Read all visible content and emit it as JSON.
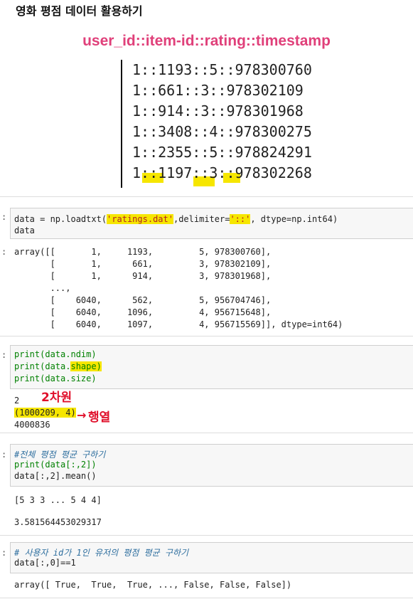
{
  "page": {
    "title": "영화 평점 데이터 활용하기",
    "subtitle": "user_id::item-id::rating::timestamp"
  },
  "rating_lines": [
    "1::1193::5::978300760",
    "1::661::3::978302109",
    "1::914::3::978301968",
    "1::3408::4::978300275",
    "1::2355::5::978824291",
    "1::1197::3::978302268"
  ],
  "cells": {
    "c1": {
      "prompt": ":",
      "code_line1": {
        "a": "data = np.loadtxt(",
        "s1": "'ratings.dat'",
        "b": ",delimiter=",
        "s2": "'::'",
        "c": ", dtype=np.int64)"
      },
      "code_line2": "data",
      "out_prompt": ":",
      "output": [
        "array([[       1,     1193,         5, 978300760],",
        "       [       1,      661,         3, 978302109],",
        "       [       1,      914,         3, 978301968],",
        "       ...,",
        "       [    6040,      562,         5, 956704746],",
        "       [    6040,     1096,         4, 956715648],",
        "       [    6040,     1097,         4, 956715569]], dtype=int64)"
      ]
    },
    "c2": {
      "prompt": ":",
      "code_line1": "print(data.ndim)",
      "code_line2_a": "print(data.",
      "code_line2_hl": "shape)",
      "code_line3": "print(data.size)",
      "output": [
        "2",
        "(1000209, 4)",
        "4000836"
      ],
      "annot_dim": "2차원",
      "annot_rowcol": "행열"
    },
    "c3": {
      "prompt": ":",
      "comment": "#전체 평점 평균 구하기",
      "code_line2": "print(data[:,2])",
      "code_line3": "data[:,2].mean()",
      "output1": "[5 3 3 ... 5 4 4]",
      "output2": "3.581564453029317"
    },
    "c4": {
      "prompt": ":",
      "comment": "# 사용자 id가 1인 유저의 평점 평균 구하기",
      "code_line2": "data[:,0]==1",
      "output": "array([ True,  True,  True, ..., False, False, False])"
    }
  }
}
